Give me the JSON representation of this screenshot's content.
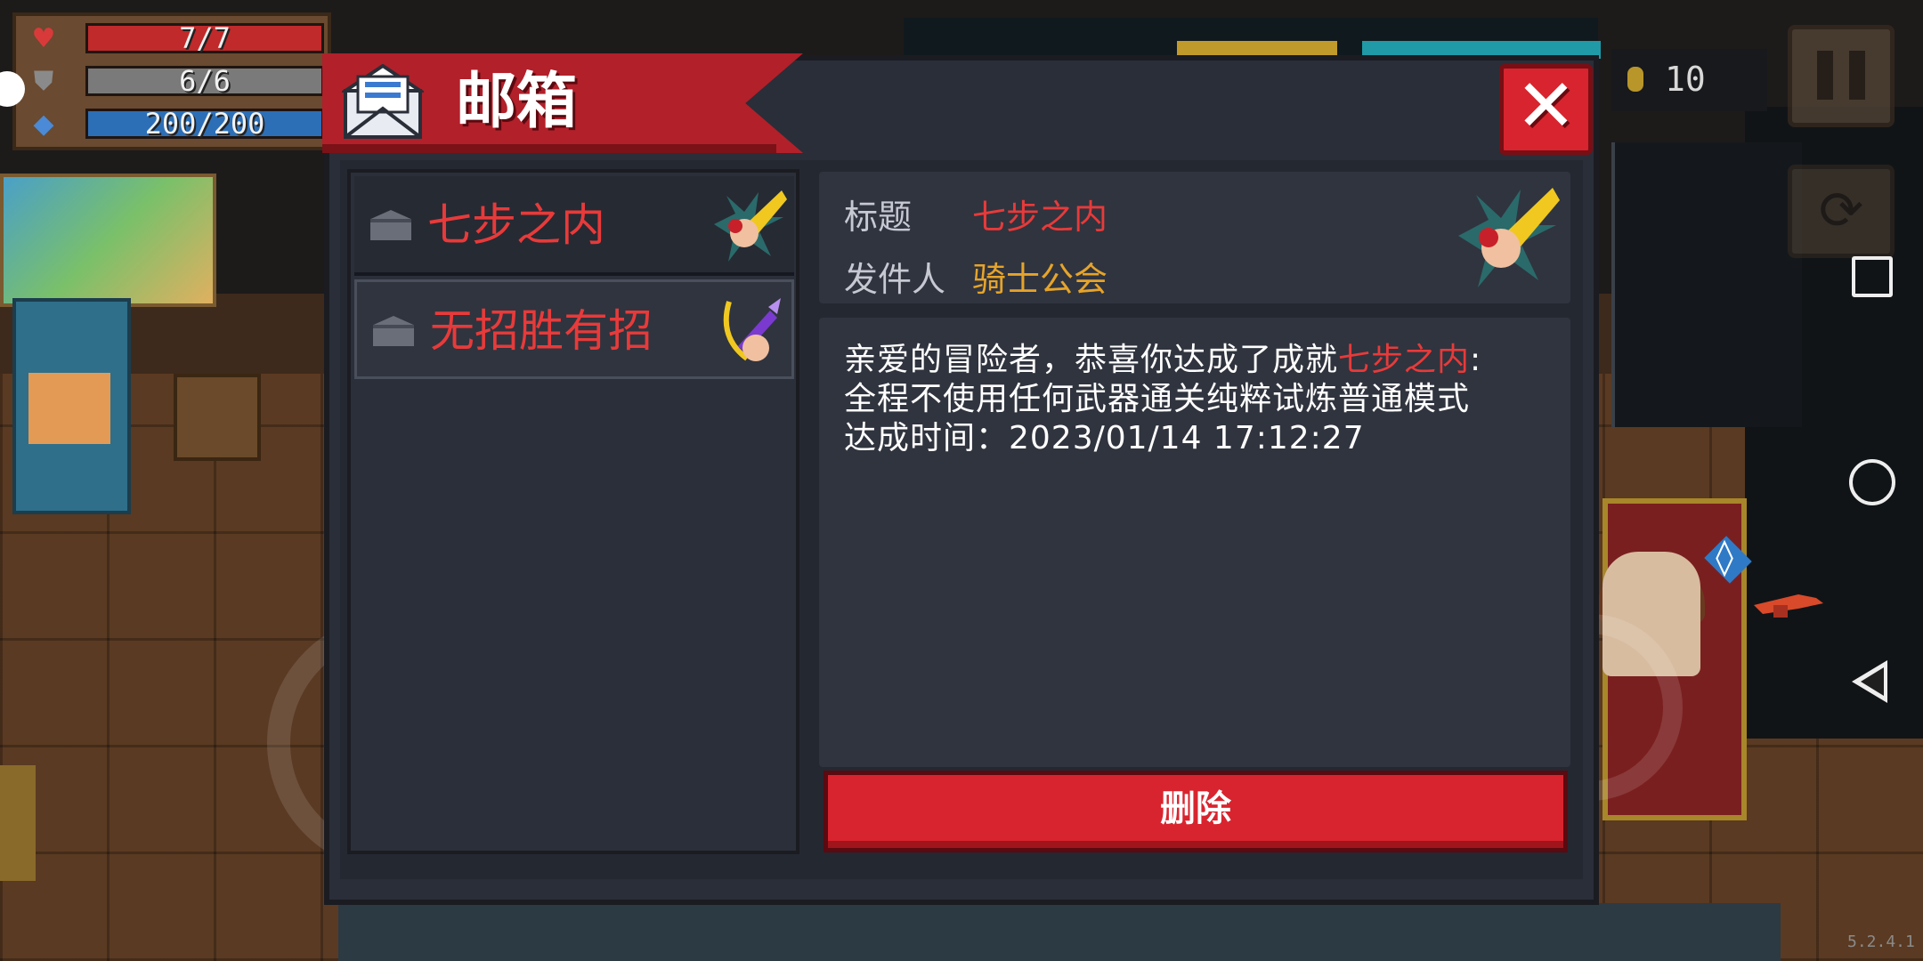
{
  "hud": {
    "hp": "7/7",
    "armor": "6/6",
    "energy": "200/200",
    "coins": "10"
  },
  "mailbox": {
    "title": "邮箱",
    "close_label": "✕",
    "mails": [
      {
        "name": "七步之内",
        "selected": false
      },
      {
        "name": "无招胜有招",
        "selected": true
      }
    ],
    "detail": {
      "title_key": "标题",
      "title_value": "七步之内",
      "sender_key": "发件人",
      "sender_value": "骑士公会",
      "message_prefix": "亲爱的冒险者，恭喜你达成了成就",
      "message_highlight": "七步之内",
      "message_suffix": ":",
      "message_line2": "全程不使用任何武器通关纯粹试炼普通模式",
      "message_line3": "达成时间：2023/01/14 17:12:27"
    },
    "delete_label": "删除"
  },
  "version": "5.2.4.1",
  "colors": {
    "accent_red": "#d8242e",
    "highlight_red": "#e83a3a",
    "sender_gold": "#e6a42a",
    "panel_bg": "#2a2e38"
  }
}
